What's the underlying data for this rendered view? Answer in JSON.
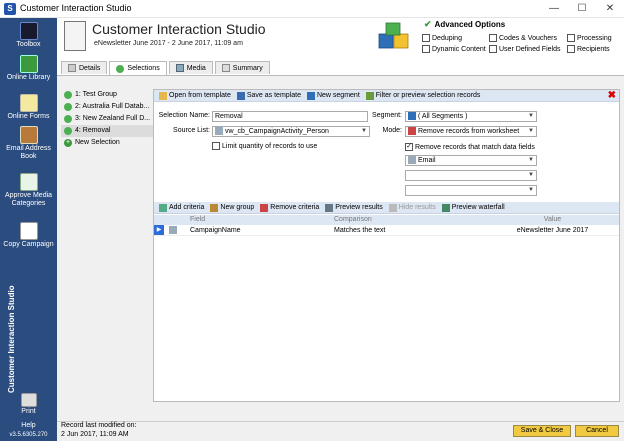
{
  "window": {
    "title": "Customer Interaction Studio",
    "app_icon": "S",
    "minimize": "—",
    "maximize": "☐",
    "close": "✕"
  },
  "sidebar": {
    "vertical_title": "Customer Interaction Studio",
    "items": [
      {
        "label": "Toolbox",
        "icon": "toolbox-icon"
      },
      {
        "label": "Online Library",
        "icon": "library-icon"
      },
      {
        "label": "Online Forms",
        "icon": "forms-icon"
      },
      {
        "label": "Email Address Book",
        "icon": "address-book-icon"
      },
      {
        "label": "Approve Media Categories",
        "icon": "approve-icon"
      },
      {
        "label": "Copy Campaign",
        "icon": "copy-icon"
      }
    ],
    "print": "Print",
    "help": "Help",
    "version": "v3.5.6305.270"
  },
  "header": {
    "title": "Customer Interaction Studio",
    "subtitle": "eNewsletter June 2017 - 2 June 2017, 11:09 am"
  },
  "advanced_options": {
    "title": "Advanced Options",
    "options": [
      {
        "label": "Deduping",
        "checked": false
      },
      {
        "label": "Codes & Vouchers",
        "checked": false
      },
      {
        "label": "Processing",
        "checked": false
      },
      {
        "label": "Dynamic Content",
        "checked": false
      },
      {
        "label": "User Defined Fields",
        "checked": false
      },
      {
        "label": "Recipients",
        "checked": false
      }
    ]
  },
  "tabs": [
    {
      "label": "Details",
      "active": false
    },
    {
      "label": "Selections",
      "active": true
    },
    {
      "label": "Media",
      "active": false
    },
    {
      "label": "Summary",
      "active": false
    }
  ],
  "selections": [
    {
      "label": "1: Test Group"
    },
    {
      "label": "2: Australia Full Datab..."
    },
    {
      "label": "3: New Zealand Full D..."
    },
    {
      "label": "4: Removal"
    },
    {
      "label": "New Selection"
    }
  ],
  "toolbar": {
    "open_template": "Open from template",
    "save_template": "Save as template",
    "new_segment": "New segment",
    "filter_preview": "Filter or preview selection records"
  },
  "form": {
    "selection_name_label": "Selection Name:",
    "selection_name_value": "Removal",
    "source_list_label": "Source List:",
    "source_list_value": "vw_cb_CampaignActivity_Person",
    "limit_label": "Limit quantity of records to use",
    "segment_label": "Segment:",
    "segment_value": "( All Segments )",
    "mode_label": "Mode:",
    "mode_value": "Remove records from worksheet",
    "match_label": "Remove records that match data fields",
    "match_field_1": "Email",
    "match_field_2": "",
    "match_field_3": ""
  },
  "criteria_toolbar": {
    "add_criteria": "Add criteria",
    "new_group": "New group",
    "remove_criteria": "Remove criteria",
    "preview_results": "Preview results",
    "hide_results": "Hide results",
    "preview_waterfall": "Preview waterfall"
  },
  "grid": {
    "headers": [
      "Field",
      "Comparison",
      "Value"
    ],
    "rows": [
      {
        "field": "CampaignName",
        "comparison": "Matches the text",
        "value": "eNewsletter June 2017"
      }
    ]
  },
  "footer": {
    "last_modified_label": "Record last modified on:",
    "last_modified_value": "2 Jun 2017, 11:09 AM",
    "save_close": "Save & Close",
    "cancel": "Cancel"
  },
  "colors": {
    "sidebar": "#2b4c7e",
    "button_yellow": "#f2ca42",
    "toolbar_blue": "#dde6f3",
    "grid_select": "#2d6bd6"
  }
}
